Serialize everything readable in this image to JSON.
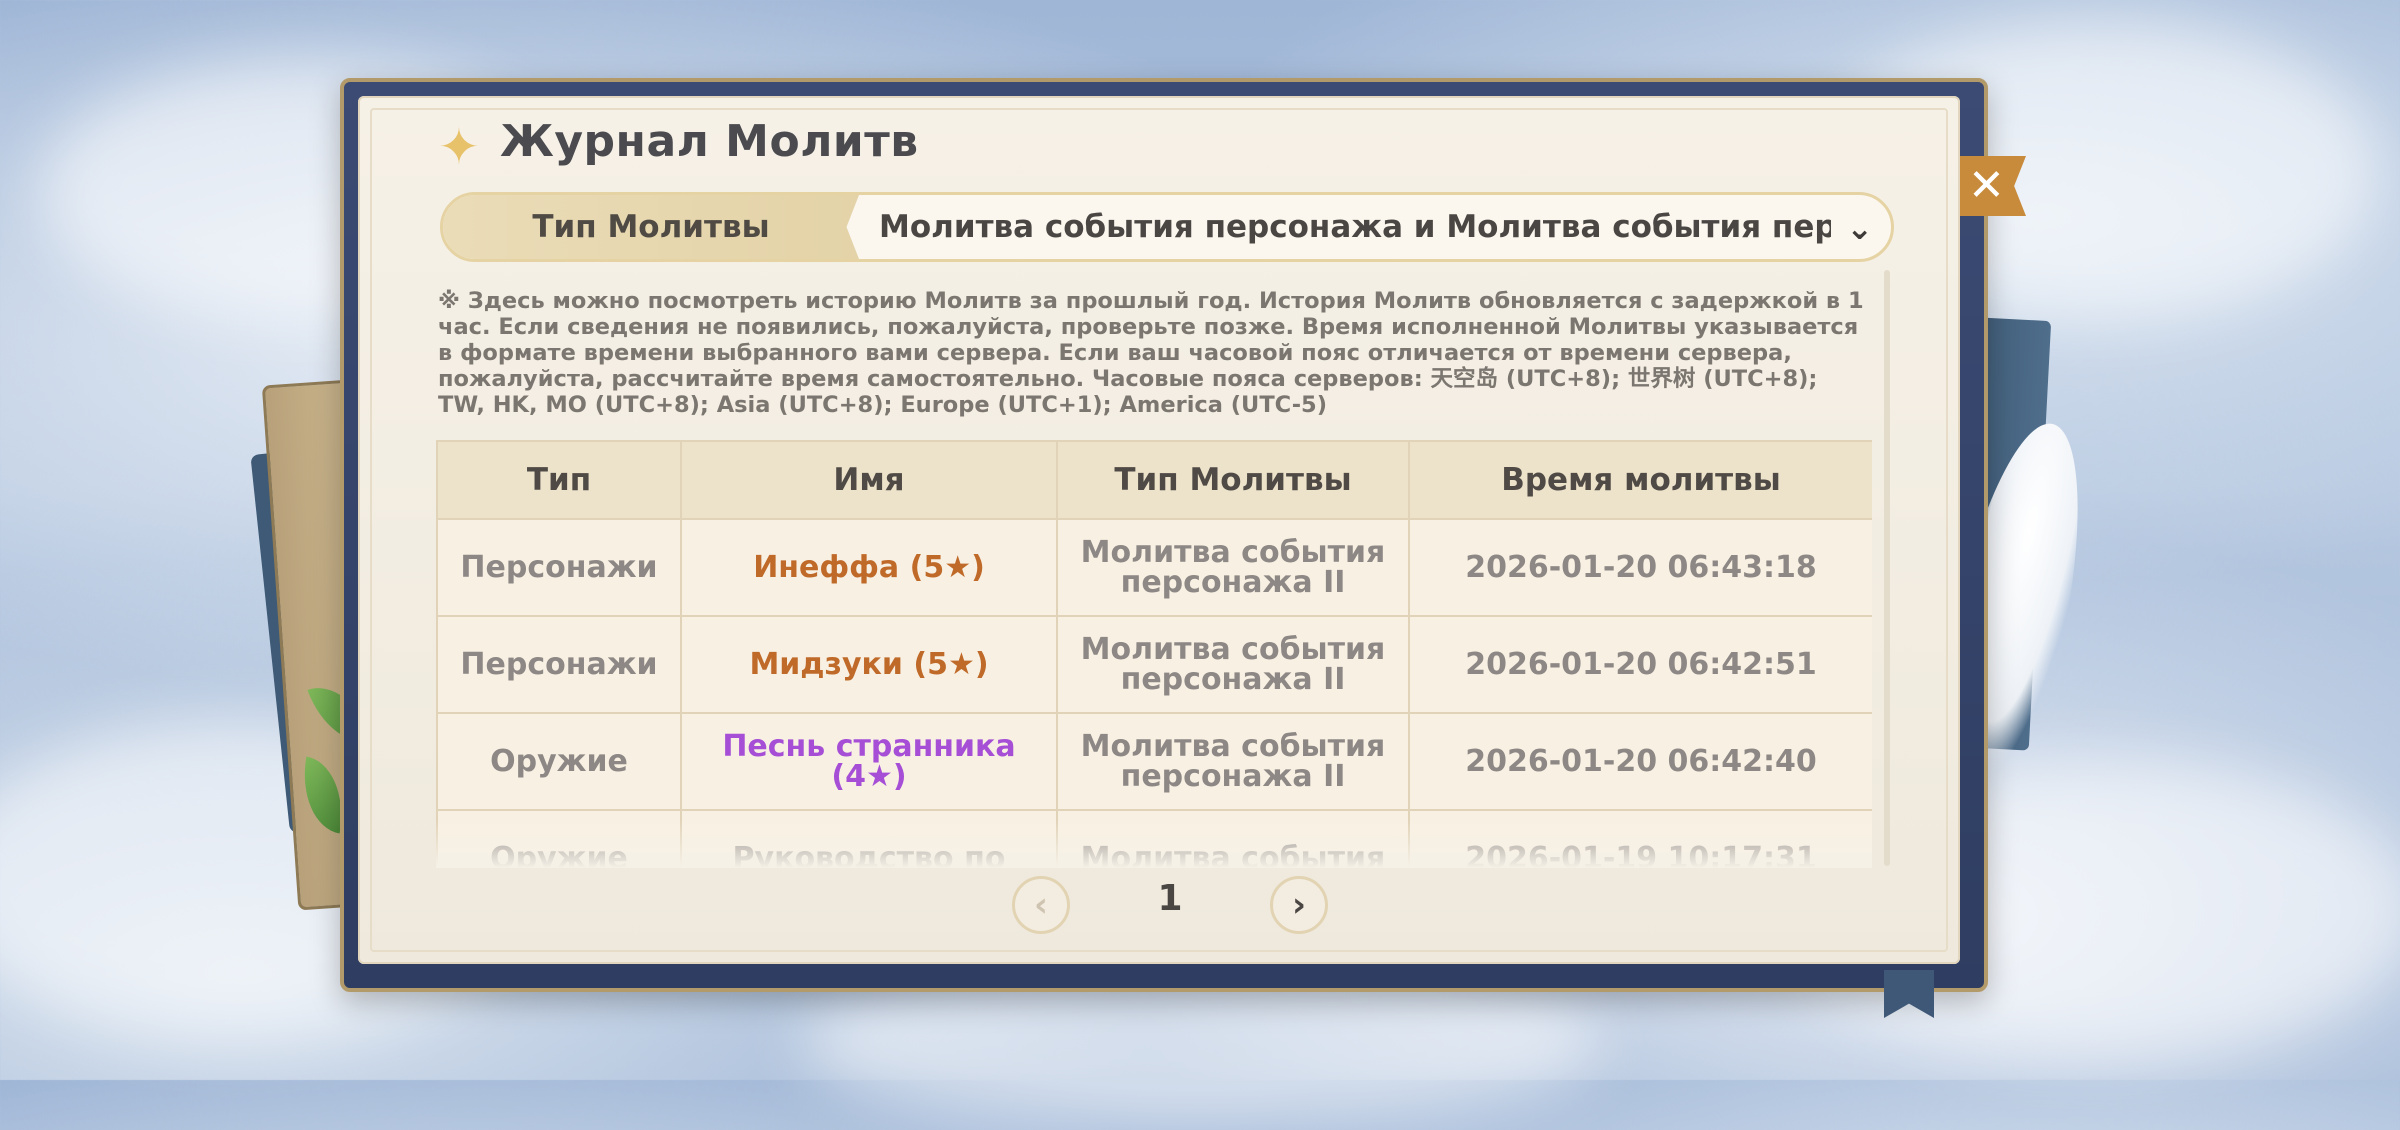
{
  "window": {
    "title": "Журнал Молитв",
    "close_icon": "close-icon"
  },
  "selector": {
    "label": "Тип Молитвы",
    "value": "Молитва события персонажа и Молитва события персо…",
    "chevron_icon": "chevron-down-icon"
  },
  "notice": "※ Здесь можно посмотреть историю Молитв за прошлый год. История Молитв обновляется с задержкой в 1 час. Если сведения не появились, пожалуйста, проверьте позже. Время исполненной Молитвы указывается в формате времени выбранного вами сервера. Если ваш часовой пояс отличается от времени сервера, пожалуйста, рассчитайте время самостоятельно. Часовые пояса серверов: 天空岛 (UTC+8); 世界树 (UTC+8); TW, HK, MO (UTC+8); Asia (UTC+8); Europe (UTC+1); America (UTC-5)",
  "table": {
    "headers": [
      "Тип",
      "Имя",
      "Тип Молитвы",
      "Время молитвы"
    ],
    "rows": [
      {
        "type": "Персонажи",
        "name": "Инеффа (5★)",
        "wish": "Молитва события персонажа II",
        "time": "2026-01-20 06:43:18"
      },
      {
        "type": "Персонажи",
        "name": "Мидзуки (5★)",
        "wish": "Молитва события персонажа II",
        "time": "2026-01-20 06:42:51"
      },
      {
        "type": "Оружие",
        "name": "Песнь странника (4★)",
        "wish": "Молитва события персонажа II",
        "time": "2026-01-20 06:42:40"
      },
      {
        "type": "Оружие",
        "name": "Руководство по",
        "wish": "Молитва события",
        "time": "2026-01-19 10:17:31"
      }
    ]
  },
  "pager": {
    "page": "1",
    "prev_icon": "chevron-left-icon",
    "next_icon": "chevron-right-icon"
  },
  "colors": {
    "five_star": "#c06a2a",
    "four_star": "#a64fd6",
    "frame": "#2f3d62",
    "paper": "#f6f1e7"
  }
}
